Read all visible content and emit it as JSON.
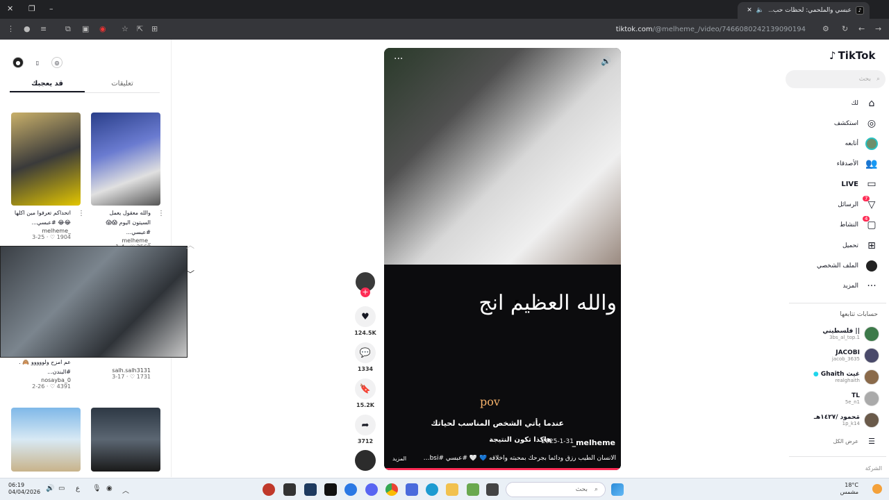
{
  "browser": {
    "tab_title": "عبسي والملحمي: لحظات حب...",
    "tab_favicon": "tiktok-icon",
    "new_tab_label": "+",
    "url_host": "tiktok.com",
    "url_path": "/@melheme_/video/7466080242139090194"
  },
  "sidebar": {
    "brand": "TikTok",
    "search_placeholder": "بحث",
    "items": [
      {
        "label": "لك",
        "icon": "home-icon"
      },
      {
        "label": "استكشف",
        "icon": "compass-icon"
      },
      {
        "label": "أتابعه",
        "icon": "following-avatar-icon"
      },
      {
        "label": "الأصدقاء",
        "icon": "friends-icon"
      },
      {
        "label": "LIVE",
        "icon": "live-icon"
      },
      {
        "label": "الرسائل",
        "icon": "messages-icon",
        "badge": "7"
      },
      {
        "label": "النشاط",
        "icon": "activity-icon",
        "badge": "4"
      },
      {
        "label": "تحميل",
        "icon": "upload-icon"
      },
      {
        "label": "الملف الشخصي",
        "icon": "profile-icon"
      },
      {
        "label": "المزيد",
        "icon": "more-icon"
      }
    ],
    "following_title": "حسابات تتابعها",
    "following": [
      {
        "name": "فلسطيني ||",
        "handle": "3bs_al_top.1"
      },
      {
        "name": "JACOBI",
        "handle": "jacob_3635"
      },
      {
        "name": "Ghaith غيث",
        "handle": "realghaith"
      },
      {
        "name": "TL",
        "handle": "5e_n1"
      },
      {
        "name": "مَحمود /١٤٢٧هـ",
        "handle": "1p_k14"
      }
    ],
    "see_all": "عرض الكل",
    "footer": "الشركة"
  },
  "video": {
    "overlay_text": "والله العظيم انج",
    "pov": "pov",
    "caption_line1": "عندما يأتي الشخص المناسب لحياتك",
    "caption_line2": "هاكذا تكون النتيجة",
    "author": "melheme_",
    "date": "2025-1-31",
    "description": "الانسان الطيب رزق ودائما بجرحك بمحبته واخلاقه 💙 🤍 #عبسي #3absi ...",
    "more_label": "المزيد"
  },
  "actions": {
    "likes": "124.5K",
    "comments": "1334",
    "saves": "15.2K",
    "shares": "3712"
  },
  "panel": {
    "tabs": [
      "تعليقات",
      "قد يعجبك"
    ],
    "active_tab": "قد يعجبك",
    "cards": [
      {
        "title": "والله معقول يعمل السيتون اليوم 😱😱 #عبسي...",
        "user": "melheme_",
        "likes": "2560",
        "date": "1-4"
      },
      {
        "title": "اتحداكم تعرفوا مين اكلها 😂😂 #عبسي...",
        "user": "melheme_",
        "likes": "1904",
        "date": "3-25"
      },
      {
        "title": "",
        "user": "salh.salh3131",
        "likes": "1731",
        "date": "3-17"
      },
      {
        "title": "عم امزح ولووووو 🙈 . #البندن...",
        "user": "nosayba_0",
        "likes": "4391",
        "date": "2-26"
      }
    ]
  },
  "taskbar": {
    "time": "06:19",
    "date": "04/04/2026",
    "search_placeholder": "بحث",
    "temp": "18°C",
    "weather": "مشمس",
    "lang": "ع"
  }
}
